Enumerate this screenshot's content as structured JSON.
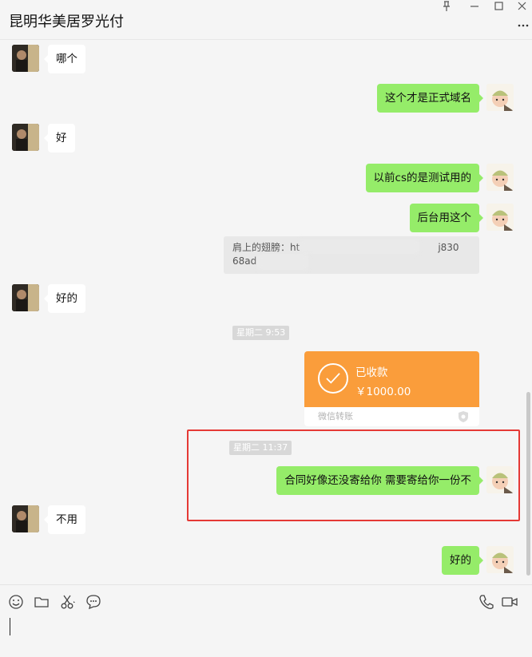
{
  "window": {
    "title": "昆明华美居罗光付",
    "controls": [
      "pin-icon",
      "minimize-icon",
      "maximize-icon",
      "close-icon"
    ]
  },
  "messages": [
    {
      "side": "left",
      "text": "哪个"
    },
    {
      "side": "right",
      "text": "这个才是正式域名"
    },
    {
      "side": "left",
      "text": "好"
    },
    {
      "side": "right",
      "text": "以前cs的是测试用的"
    },
    {
      "side": "right",
      "text": "后台用这个"
    },
    {
      "side": "left",
      "text": "好的"
    },
    {
      "side": "left",
      "text": "不用"
    },
    {
      "side": "right",
      "text": "好的"
    }
  ],
  "link_card": {
    "line1": "肩上的翅膀：ht",
    "line1_end": "j830",
    "line2": "68ad"
  },
  "timestamps": {
    "first": "星期二 9:53",
    "second": "星期二 11:37"
  },
  "transfer": {
    "status": "已收款",
    "amount": "￥1000.00",
    "footer": "微信转账"
  },
  "highlighted_message": "合同好像还没寄给你  需要寄给你一份不",
  "colors": {
    "sent_bubble": "#95ec69",
    "received_bubble": "#ffffff",
    "transfer": "#fa9d3b",
    "highlight": "#e53935"
  },
  "toolbar": {
    "left_icons": [
      "emoji-icon",
      "folder-icon",
      "scissors-icon",
      "chat-history-icon"
    ],
    "right_icons": [
      "phone-icon",
      "video-icon"
    ]
  }
}
